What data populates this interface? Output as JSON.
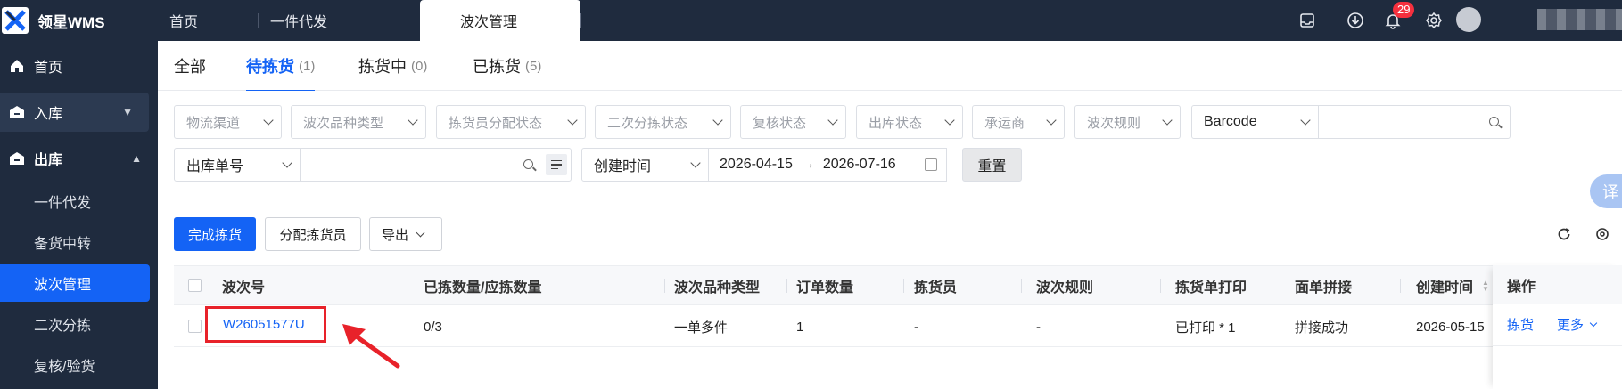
{
  "app": {
    "name": "领星WMS"
  },
  "top_tabs": [
    {
      "label": "首页"
    },
    {
      "label": "一件代发"
    },
    {
      "label": "波次管理"
    }
  ],
  "notifications": {
    "count": "29"
  },
  "sidebar": {
    "items": [
      {
        "label": "首页",
        "icon": "home-icon"
      },
      {
        "label": "入库",
        "icon": "inbound-icon"
      },
      {
        "label": "出库",
        "icon": "outbound-icon"
      }
    ],
    "sub_items": [
      {
        "label": "一件代发"
      },
      {
        "label": "备货中转"
      },
      {
        "label": "波次管理"
      },
      {
        "label": "二次分拣"
      },
      {
        "label": "复核/验货"
      }
    ]
  },
  "tabs": [
    {
      "label": "全部",
      "count": ""
    },
    {
      "label": "待拣货",
      "count": "(1)"
    },
    {
      "label": "拣货中",
      "count": "(0)"
    },
    {
      "label": "已拣货",
      "count": "(5)"
    }
  ],
  "filters": {
    "row1": [
      "物流渠道",
      "波次品种类型",
      "拣货员分配状态",
      "二次分拣状态",
      "复核状态",
      "出库状态",
      "承运商",
      "波次规则"
    ],
    "barcode_select": "Barcode",
    "order_select": "出库单号",
    "date_type": "创建时间",
    "date_start": "2026-04-15",
    "date_end": "2026-07-16",
    "reset_label": "重置"
  },
  "actions": {
    "complete": "完成拣货",
    "assign": "分配拣货员",
    "export": "导出"
  },
  "table": {
    "headers": [
      "波次号",
      "已拣数量/应拣数量",
      "波次品种类型",
      "订单数量",
      "拣货员",
      "波次规则",
      "拣货单打印",
      "面单拼接",
      "创建时间",
      "操作"
    ],
    "rows": [
      {
        "wave_no": "W26051577U",
        "picked": "0/3",
        "type": "一单多件",
        "orders": "1",
        "picker": "-",
        "rule": "-",
        "print": "已打印 * 1",
        "splice": "拼接成功",
        "created": "2026-05-15",
        "op_pick": "拣货",
        "op_more": "更多"
      }
    ]
  },
  "translate_label": "译",
  "colors": {
    "brand": "#1463f5",
    "nav_bg": "#1f2b3e",
    "highlight": "#e8222a"
  }
}
